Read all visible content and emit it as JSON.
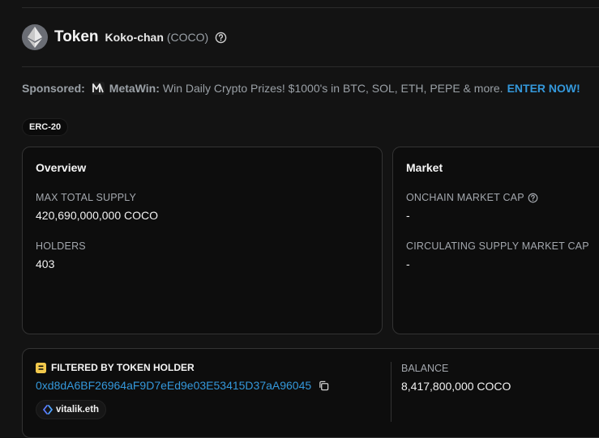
{
  "header": {
    "title": "Token",
    "token_name": "Koko-chan",
    "token_symbol": "(COCO)"
  },
  "sponsored": {
    "label": "Sponsored:",
    "brand": "MetaWin:",
    "text": "Win Daily Crypto Prizes! $1000's in BTC, SOL, ETH, PEPE & more.",
    "cta": "ENTER NOW!"
  },
  "standard_badge": "ERC-20",
  "overview": {
    "title": "Overview",
    "max_supply_label": "MAX TOTAL SUPPLY",
    "max_supply_value": "420,690,000,000 COCO",
    "holders_label": "HOLDERS",
    "holders_value": "403"
  },
  "market": {
    "title": "Market",
    "onchain_cap_label": "ONCHAIN MARKET CAP",
    "onchain_cap_value": "-",
    "circ_cap_label": "CIRCULATING SUPPLY MARKET CAP",
    "circ_cap_value": "-"
  },
  "filter": {
    "title": "FILTERED BY TOKEN HOLDER",
    "address": "0xd8dA6BF26964aF9D7eEd9e03E53415D37aA96045",
    "ens_name": "vitalik.eth",
    "balance_label": "BALANCE",
    "balance_value": "8,417,800,000 COCO"
  },
  "colors": {
    "background": "#131313",
    "card": "#0d0d0d",
    "link": "#3498db",
    "muted": "#9aa0a6",
    "filter_icon": "#f2c94c"
  },
  "icons": [
    "ethereum-icon",
    "help-circle-icon",
    "metawin-icon",
    "filter-icon",
    "copy-icon",
    "ens-icon"
  ]
}
